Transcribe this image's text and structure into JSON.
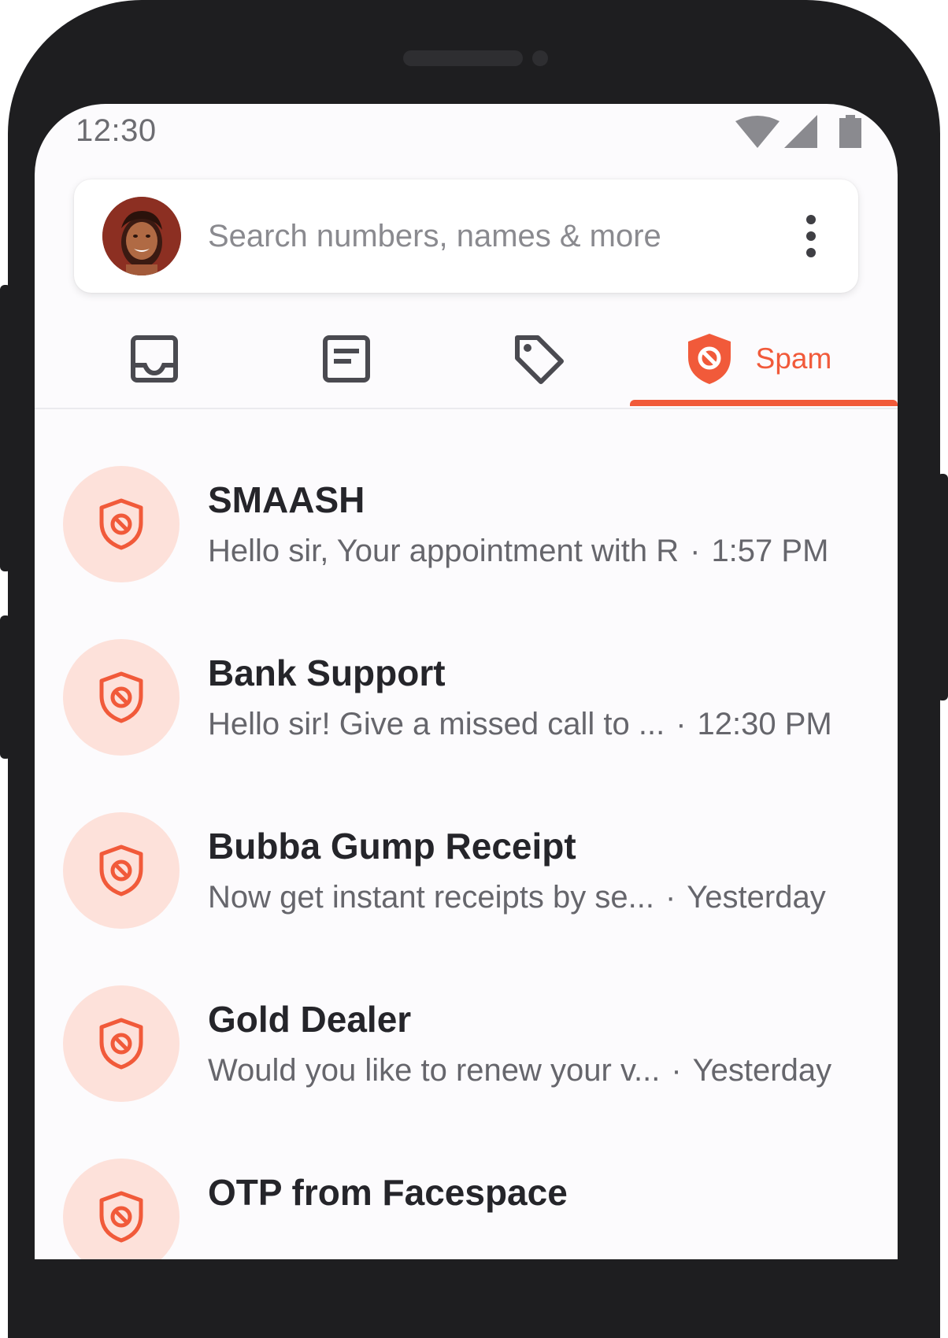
{
  "statusbar": {
    "time": "12:30",
    "icons": [
      "wifi-icon",
      "cell-signal-icon",
      "battery-icon"
    ]
  },
  "search": {
    "placeholder": "Search numbers, names & more",
    "avatar": "user-avatar",
    "menu_icon": "more-vert-icon"
  },
  "tabs": [
    {
      "icon": "inbox-icon",
      "label": ""
    },
    {
      "icon": "receipt-icon",
      "label": ""
    },
    {
      "icon": "tag-icon",
      "label": ""
    },
    {
      "icon": "spam-shield-icon",
      "label": "Spam",
      "active": true
    }
  ],
  "messages": [
    {
      "sender": "SMAASH",
      "preview": "Hello sir, Your appointment with R",
      "time": "1:57 PM"
    },
    {
      "sender": "Bank Support",
      "preview": "Hello sir! Give a missed call to ...",
      "time": "12:30 PM"
    },
    {
      "sender": "Bubba Gump Receipt",
      "preview": "Now get instant receipts by se...",
      "time": "Yesterday"
    },
    {
      "sender": "Gold Dealer",
      "preview": "Would you like to renew your v...",
      "time": "Yesterday"
    },
    {
      "sender": "OTP from Facespace",
      "preview": "",
      "time": ""
    }
  ],
  "colors": {
    "accent": "#f15a3a",
    "spam_avatar_bg": "#fde1da",
    "phone_frame": "#1e1e20"
  }
}
